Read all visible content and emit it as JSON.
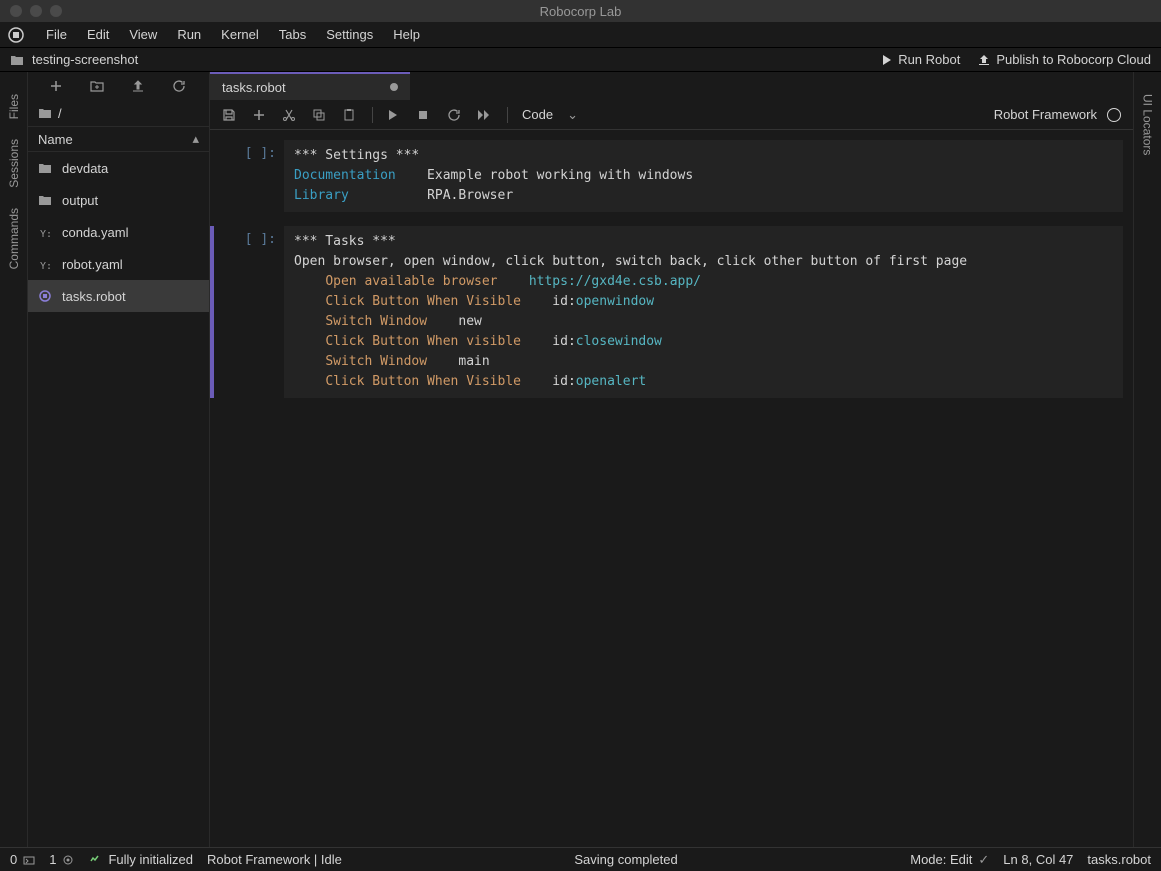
{
  "window": {
    "title": "Robocorp Lab"
  },
  "menu": {
    "items": [
      "File",
      "Edit",
      "View",
      "Run",
      "Kernel",
      "Tabs",
      "Settings",
      "Help"
    ]
  },
  "project": {
    "name": "testing-screenshot"
  },
  "actions": {
    "run": "Run Robot",
    "publish": "Publish to Robocorp Cloud"
  },
  "leftRail": {
    "items": [
      "Files",
      "Sessions",
      "Commands"
    ]
  },
  "rightRail": {
    "items": [
      "UI Locators"
    ]
  },
  "sidebar": {
    "path": "/",
    "header": "Name",
    "files": [
      {
        "name": "devdata",
        "type": "folder"
      },
      {
        "name": "output",
        "type": "folder"
      },
      {
        "name": "conda.yaml",
        "type": "yaml"
      },
      {
        "name": "robot.yaml",
        "type": "yaml"
      },
      {
        "name": "tasks.robot",
        "type": "robot",
        "selected": true
      }
    ]
  },
  "tabs": [
    {
      "name": "tasks.robot",
      "dirty": true
    }
  ],
  "editorToolbar": {
    "cellType": "Code",
    "language": "Robot Framework"
  },
  "cells": [
    {
      "prompt": "[ ]:",
      "lines": [
        [
          {
            "cls": "kw-section",
            "t": "*** Settings ***"
          }
        ],
        [
          {
            "cls": "kw-setting",
            "t": "Documentation"
          },
          {
            "cls": "kw-value",
            "t": "    Example robot working with windows"
          }
        ],
        [
          {
            "cls": "kw-setting",
            "t": "Library"
          },
          {
            "cls": "kw-value",
            "t": "          RPA.Browser"
          }
        ]
      ]
    },
    {
      "prompt": "[ ]:",
      "active": true,
      "lines": [
        [
          {
            "cls": "kw-section",
            "t": "*** Tasks ***"
          }
        ],
        [
          {
            "cls": "kw-name",
            "t": "Open browser, open window, click button, switch back, click other button of first page"
          }
        ],
        [
          {
            "cls": "",
            "t": "    "
          },
          {
            "cls": "kw-action",
            "t": "Open available browser"
          },
          {
            "cls": "",
            "t": "    "
          },
          {
            "cls": "kw-url",
            "t": "https://gxd4e.csb.app/"
          }
        ],
        [
          {
            "cls": "",
            "t": "    "
          },
          {
            "cls": "kw-action",
            "t": "Click Button When Visible"
          },
          {
            "cls": "",
            "t": "    id:"
          },
          {
            "cls": "kw-id",
            "t": "openwindow"
          }
        ],
        [
          {
            "cls": "",
            "t": "    "
          },
          {
            "cls": "kw-action",
            "t": "Switch Window"
          },
          {
            "cls": "",
            "t": "    "
          },
          {
            "cls": "kw-arg",
            "t": "new"
          }
        ],
        [
          {
            "cls": "",
            "t": "    "
          },
          {
            "cls": "kw-action",
            "t": "Click Button When visible"
          },
          {
            "cls": "",
            "t": "    id:"
          },
          {
            "cls": "kw-id",
            "t": "closewindow"
          }
        ],
        [
          {
            "cls": "",
            "t": "    "
          },
          {
            "cls": "kw-action",
            "t": "Switch Window"
          },
          {
            "cls": "",
            "t": "    "
          },
          {
            "cls": "kw-arg",
            "t": "main"
          }
        ],
        [
          {
            "cls": "",
            "t": "    "
          },
          {
            "cls": "kw-action",
            "t": "Click Button When Visible"
          },
          {
            "cls": "",
            "t": "    id:"
          },
          {
            "cls": "kw-id",
            "t": "openalert"
          }
        ]
      ]
    }
  ],
  "status": {
    "left0": "0",
    "left1": "1",
    "init": "Fully initialized",
    "kernel": "Robot Framework | Idle",
    "center": "Saving completed",
    "mode": "Mode: Edit",
    "pos": "Ln 8, Col 47",
    "file": "tasks.robot"
  }
}
